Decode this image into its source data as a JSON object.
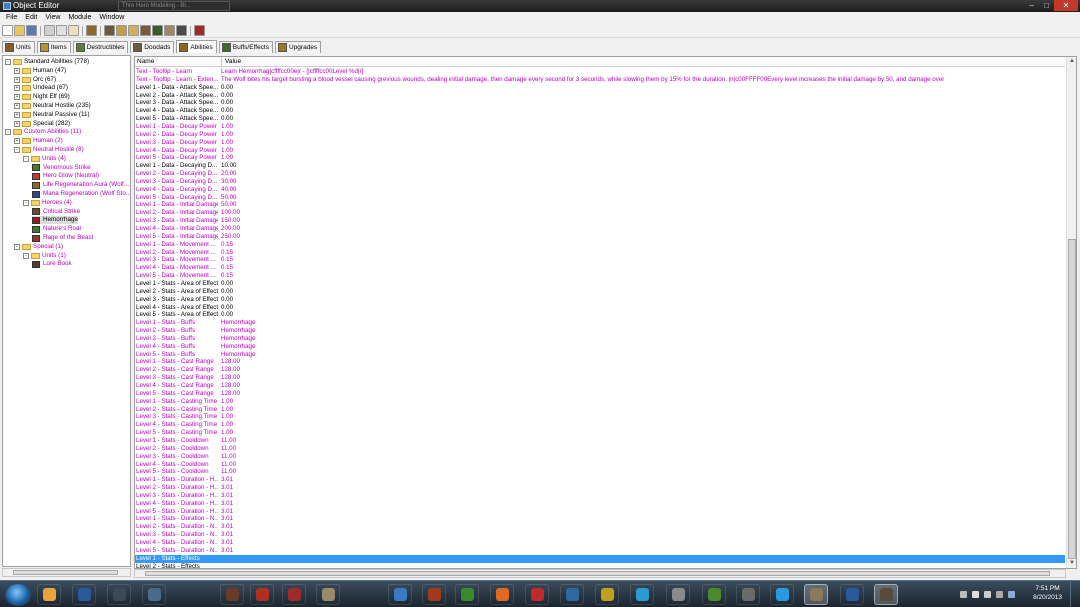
{
  "window": {
    "title": "Object Editor",
    "background_tab_label": "Thre Hero Modeling - Bl..."
  },
  "menu": [
    "File",
    "Edit",
    "View",
    "Module",
    "Window"
  ],
  "tabs": [
    {
      "label": "Units",
      "color": "#8a5a2b"
    },
    {
      "label": "Items",
      "color": "#b8922e"
    },
    {
      "label": "Destructibles",
      "color": "#5c7c3a"
    },
    {
      "label": "Doodads",
      "color": "#6b5c3a"
    },
    {
      "label": "Abilities",
      "color": "#8a6a1f"
    },
    {
      "label": "Buffs/Effects",
      "color": "#3f6b2e"
    },
    {
      "label": "Upgrades",
      "color": "#9a7a1f"
    }
  ],
  "active_tab": "Abilities",
  "tree": [
    {
      "label": "Standard Abilities (778)",
      "depth": 0,
      "type": "folder",
      "exp": "-",
      "custom": false
    },
    {
      "label": "Human (47)",
      "depth": 1,
      "type": "folder",
      "exp": "+",
      "custom": false
    },
    {
      "label": "Orc (67)",
      "depth": 1,
      "type": "folder",
      "exp": "+",
      "custom": false
    },
    {
      "label": "Undead (67)",
      "depth": 1,
      "type": "folder",
      "exp": "+",
      "custom": false
    },
    {
      "label": "Night Elf (69)",
      "depth": 1,
      "type": "folder",
      "exp": "+",
      "custom": false
    },
    {
      "label": "Neutral Hostile (235)",
      "depth": 1,
      "type": "folder",
      "exp": "+",
      "custom": false
    },
    {
      "label": "Neutral Passive (11)",
      "depth": 1,
      "type": "folder",
      "exp": "+",
      "custom": false
    },
    {
      "label": "Special (282)",
      "depth": 1,
      "type": "folder",
      "exp": "+",
      "custom": false
    },
    {
      "label": "Custom Abilities (11)",
      "depth": 0,
      "type": "folder",
      "exp": "-",
      "custom": true
    },
    {
      "label": "Human (2)",
      "depth": 1,
      "type": "folder",
      "exp": "+",
      "custom": true
    },
    {
      "label": "Neutral Hostile (8)",
      "depth": 1,
      "type": "folder",
      "exp": "-",
      "custom": true
    },
    {
      "label": "Units (4)",
      "depth": 2,
      "type": "folder",
      "exp": "-",
      "custom": true
    },
    {
      "label": "Venomous Strike",
      "depth": 3,
      "type": "leaf",
      "custom": true,
      "icon_color": "#4a7a2a"
    },
    {
      "label": "Hero Glow (Neutral)",
      "depth": 3,
      "type": "leaf",
      "custom": true,
      "icon_color": "#c23a2a"
    },
    {
      "label": "Life Regeneration Aura (Wolf...",
      "depth": 3,
      "type": "leaf",
      "custom": true,
      "icon_color": "#8a6a2a"
    },
    {
      "label": "Mana Regeneration (Wolf Sto...",
      "depth": 3,
      "type": "leaf",
      "custom": true,
      "icon_color": "#2a4a8a"
    },
    {
      "label": "Heroes (4)",
      "depth": 2,
      "type": "folder",
      "exp": "-",
      "custom": true
    },
    {
      "label": "Critical Strike",
      "depth": 3,
      "type": "leaf",
      "custom": true,
      "icon_color": "#6a4a2a"
    },
    {
      "label": "Hemorrhage",
      "depth": 3,
      "type": "leaf",
      "custom": false,
      "icon_color": "#9a1a1a",
      "selected": true
    },
    {
      "label": "Nature's Roar",
      "depth": 3,
      "type": "leaf",
      "custom": true,
      "icon_color": "#3a7a3a"
    },
    {
      "label": "Rage of the Beast",
      "depth": 3,
      "type": "leaf",
      "custom": true,
      "icon_color": "#a03020"
    },
    {
      "label": "Special (1)",
      "depth": 1,
      "type": "folder",
      "exp": "-",
      "custom": true
    },
    {
      "label": "Units (1)",
      "depth": 2,
      "type": "folder",
      "exp": "-",
      "custom": true
    },
    {
      "label": "Lore Book",
      "depth": 3,
      "type": "leaf",
      "custom": true,
      "icon_color": "#5a3a2a"
    }
  ],
  "grid": {
    "header_name": "Name",
    "header_value": "Value",
    "rows": [
      {
        "name": "Text - Tooltip - Learn",
        "value": "Learn Hemorrhag|cffffcc00e|r - [|cffffcc00Level %d|r]",
        "custom": true
      },
      {
        "name": "Text - Tooltip - Learn - Exten...",
        "value": "The Wolf bites his target bursting a blood vessel causing grevious wounds, dealing initial damage, then damage every second for 3 seconds, while slowing them by 15% for the duration. |n|c00FFFF00Every level increases the initial damage by 50, and damage over",
        "custom": true
      },
      {
        "name": "Level 1 - Data - Attack Spee...",
        "value": "0.00",
        "custom": false
      },
      {
        "name": "Level 2 - Data - Attack Spee...",
        "value": "0.00",
        "custom": false
      },
      {
        "name": "Level 3 - Data - Attack Spee...",
        "value": "0.00",
        "custom": false
      },
      {
        "name": "Level 4 - Data - Attack Spee...",
        "value": "0.00",
        "custom": false
      },
      {
        "name": "Level 5 - Data - Attack Spee...",
        "value": "0.00",
        "custom": false
      },
      {
        "name": "Level 1 - Data - Decay Power",
        "value": "1.00",
        "custom": true
      },
      {
        "name": "Level 2 - Data - Decay Power",
        "value": "1.00",
        "custom": true
      },
      {
        "name": "Level 3 - Data - Decay Power",
        "value": "1.00",
        "custom": true
      },
      {
        "name": "Level 4 - Data - Decay Power",
        "value": "1.00",
        "custom": true
      },
      {
        "name": "Level 5 - Data - Decay Power",
        "value": "1.00",
        "custom": true
      },
      {
        "name": "Level 1 - Data - Decaying D...",
        "value": "10.00",
        "custom": false
      },
      {
        "name": "Level 2 - Data - Decaying D...",
        "value": "20.00",
        "custom": true
      },
      {
        "name": "Level 3 - Data - Decaying D...",
        "value": "30.00",
        "custom": true
      },
      {
        "name": "Level 4 - Data - Decaying D...",
        "value": "40.00",
        "custom": true
      },
      {
        "name": "Level 5 - Data - Decaying D...",
        "value": "50.00",
        "custom": true
      },
      {
        "name": "Level 1 - Data - Initial Damage",
        "value": "50.00",
        "custom": true
      },
      {
        "name": "Level 2 - Data - Initial Damage",
        "value": "100.00",
        "custom": true
      },
      {
        "name": "Level 3 - Data - Initial Damage",
        "value": "150.00",
        "custom": true
      },
      {
        "name": "Level 4 - Data - Initial Damage",
        "value": "200.00",
        "custom": true
      },
      {
        "name": "Level 5 - Data - Initial Damage",
        "value": "250.00",
        "custom": true
      },
      {
        "name": "Level 1 - Data - Movement ...",
        "value": "0.15",
        "custom": true
      },
      {
        "name": "Level 2 - Data - Movement ...",
        "value": "0.15",
        "custom": true
      },
      {
        "name": "Level 3 - Data - Movement ...",
        "value": "0.15",
        "custom": true
      },
      {
        "name": "Level 4 - Data - Movement ...",
        "value": "0.15",
        "custom": true
      },
      {
        "name": "Level 5 - Data - Movement ...",
        "value": "0.15",
        "custom": true
      },
      {
        "name": "Level 1 - Stats - Area of Effect",
        "value": "0.00",
        "custom": false
      },
      {
        "name": "Level 2 - Stats - Area of Effect",
        "value": "0.00",
        "custom": false
      },
      {
        "name": "Level 3 - Stats - Area of Effect",
        "value": "0.00",
        "custom": false
      },
      {
        "name": "Level 4 - Stats - Area of Effect",
        "value": "0.00",
        "custom": false
      },
      {
        "name": "Level 5 - Stats - Area of Effect",
        "value": "0.00",
        "custom": false
      },
      {
        "name": "Level 1 - Stats - Buffs",
        "value": "Hemorrhage",
        "custom": true
      },
      {
        "name": "Level 2 - Stats - Buffs",
        "value": "Hemorrhage",
        "custom": true
      },
      {
        "name": "Level 3 - Stats - Buffs",
        "value": "Hemorrhage",
        "custom": true
      },
      {
        "name": "Level 4 - Stats - Buffs",
        "value": "Hemorrhage",
        "custom": true
      },
      {
        "name": "Level 5 - Stats - Buffs",
        "value": "Hemorrhage",
        "custom": true
      },
      {
        "name": "Level 1 - Stats - Cast Range",
        "value": "128.00",
        "custom": true
      },
      {
        "name": "Level 2 - Stats - Cast Range",
        "value": "128.00",
        "custom": true
      },
      {
        "name": "Level 3 - Stats - Cast Range",
        "value": "128.00",
        "custom": true
      },
      {
        "name": "Level 4 - Stats - Cast Range",
        "value": "128.00",
        "custom": true
      },
      {
        "name": "Level 5 - Stats - Cast Range",
        "value": "128.00",
        "custom": true
      },
      {
        "name": "Level 1 - Stats - Casting Time",
        "value": "1.00",
        "custom": true
      },
      {
        "name": "Level 2 - Stats - Casting Time",
        "value": "1.00",
        "custom": true
      },
      {
        "name": "Level 3 - Stats - Casting Time",
        "value": "1.00",
        "custom": true
      },
      {
        "name": "Level 4 - Stats - Casting Time",
        "value": "1.00",
        "custom": true
      },
      {
        "name": "Level 5 - Stats - Casting Time",
        "value": "1.00",
        "custom": true
      },
      {
        "name": "Level 1 - Stats - Cooldown",
        "value": "11.00",
        "custom": true
      },
      {
        "name": "Level 2 - Stats - Cooldown",
        "value": "11.00",
        "custom": true
      },
      {
        "name": "Level 3 - Stats - Cooldown",
        "value": "11.00",
        "custom": true
      },
      {
        "name": "Level 4 - Stats - Cooldown",
        "value": "11.00",
        "custom": true
      },
      {
        "name": "Level 5 - Stats - Cooldown",
        "value": "11.00",
        "custom": true
      },
      {
        "name": "Level 1 - Stats - Duration - H...",
        "value": "3.01",
        "custom": true
      },
      {
        "name": "Level 2 - Stats - Duration - H...",
        "value": "3.01",
        "custom": true
      },
      {
        "name": "Level 3 - Stats - Duration - H...",
        "value": "3.01",
        "custom": true
      },
      {
        "name": "Level 4 - Stats - Duration - H...",
        "value": "3.01",
        "custom": true
      },
      {
        "name": "Level 5 - Stats - Duration - H...",
        "value": "3.01",
        "custom": true
      },
      {
        "name": "Level 1 - Stats - Duration - N...",
        "value": "3.01",
        "custom": true
      },
      {
        "name": "Level 2 - Stats - Duration - N...",
        "value": "3.01",
        "custom": true
      },
      {
        "name": "Level 3 - Stats - Duration - N...",
        "value": "3.01",
        "custom": true
      },
      {
        "name": "Level 4 - Stats - Duration - N...",
        "value": "3.01",
        "custom": true
      },
      {
        "name": "Level 5 - Stats - Duration - N...",
        "value": "3.01",
        "custom": true
      },
      {
        "name": "Level 1 - Stats - Effects",
        "value": "",
        "custom": true,
        "selected": true
      },
      {
        "name": "Level 2 - Stats - Effects",
        "value": "",
        "custom": false
      }
    ]
  },
  "colors": {
    "custom_text": "#c000c0",
    "selection": "#3399ff"
  },
  "taskbar": {
    "apps": [
      {
        "name": "chrome-icon",
        "color": "#e8a33a"
      },
      {
        "name": "league-icon",
        "color": "#2a5a9a"
      },
      {
        "name": "steam-icon",
        "color": "#3a4a5a"
      },
      {
        "name": "moon-icon",
        "color": "#4a6a8a"
      },
      {
        "name": "game-icon",
        "color": "#6a3a2a"
      },
      {
        "name": "anarchy-icon",
        "color": "#b03020"
      },
      {
        "name": "potion-icon",
        "color": "#a02a2a"
      },
      {
        "name": "paper-icon",
        "color": "#9a8a6a"
      },
      {
        "name": "itunes-icon",
        "color": "#3a7ac0"
      },
      {
        "name": "diablo-icon",
        "color": "#a03a1a"
      },
      {
        "name": "utorrent-icon",
        "color": "#3a8a2a"
      },
      {
        "name": "origin-icon",
        "color": "#e06a20"
      },
      {
        "name": "raid-icon",
        "color": "#c02a2a"
      },
      {
        "name": "bolt-icon",
        "color": "#2a6aa0"
      },
      {
        "name": "curse-icon",
        "color": "#c0a020"
      },
      {
        "name": "play-icon",
        "color": "#2a9ad0"
      },
      {
        "name": "recycle-icon",
        "color": "#8a8a8a"
      },
      {
        "name": "minecraft-icon",
        "color": "#4a8a2a"
      },
      {
        "name": "anvil-icon",
        "color": "#6a6a6a"
      },
      {
        "name": "skype-icon",
        "color": "#2a9ae0"
      },
      {
        "name": "worldedit-icon",
        "color": "#8a7a5a"
      },
      {
        "name": "league-launcher-icon",
        "color": "#2a5a9a"
      },
      {
        "name": "editor-icon",
        "color": "#5a4a3a"
      }
    ],
    "active_apps": [
      "worldedit-icon",
      "editor-icon"
    ],
    "time": "7:51 PM",
    "date": "8/20/2013"
  }
}
